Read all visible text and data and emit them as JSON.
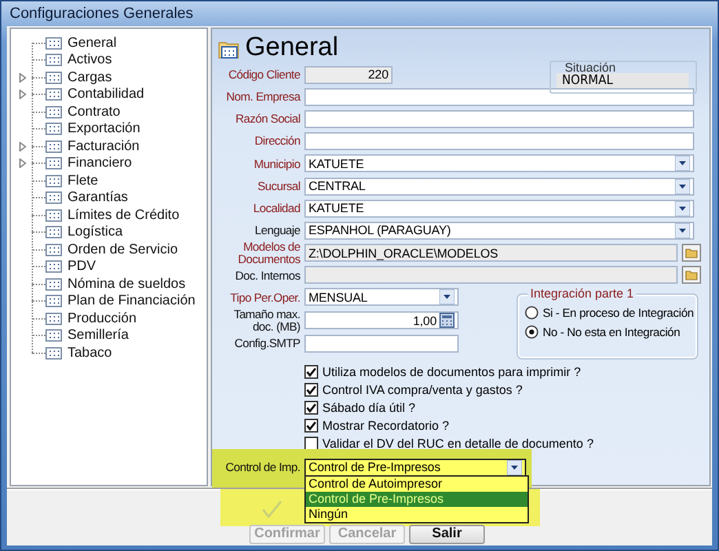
{
  "window": {
    "title": "Configuraciones Generales"
  },
  "tree": {
    "items": [
      {
        "label": "General",
        "expandable": false
      },
      {
        "label": "Activos",
        "expandable": false
      },
      {
        "label": "Cargas",
        "expandable": true
      },
      {
        "label": "Contabilidad",
        "expandable": true
      },
      {
        "label": "Contrato",
        "expandable": false
      },
      {
        "label": "Exportación",
        "expandable": false
      },
      {
        "label": "Facturación",
        "expandable": true
      },
      {
        "label": "Financiero",
        "expandable": true
      },
      {
        "label": "Flete",
        "expandable": false
      },
      {
        "label": "Garantías",
        "expandable": false
      },
      {
        "label": "Límites de Crédito",
        "expandable": false
      },
      {
        "label": "Logística",
        "expandable": false
      },
      {
        "label": "Orden de Servicio",
        "expandable": false
      },
      {
        "label": "PDV",
        "expandable": false
      },
      {
        "label": "Nómina de sueldos",
        "expandable": false
      },
      {
        "label": "Plan de Financiación",
        "expandable": false
      },
      {
        "label": "Producción",
        "expandable": false
      },
      {
        "label": "Semillería",
        "expandable": false
      },
      {
        "label": "Tabaco",
        "expandable": false
      }
    ]
  },
  "header": {
    "title": "General"
  },
  "codigo_cliente": {
    "label": "Código Cliente",
    "value": "220",
    "required": true,
    "disabled": true
  },
  "situacion": {
    "label": "Situación",
    "value": "NORMAL"
  },
  "fields": [
    {
      "kind": "text",
      "label": "Nom. Empresa",
      "required": true,
      "disabled": false
    },
    {
      "kind": "text",
      "label": "Razón Social",
      "required": true,
      "disabled": false
    },
    {
      "kind": "text",
      "label": "Dirección",
      "required": true,
      "disabled": false
    },
    {
      "kind": "combo",
      "label": "Municipio",
      "value": "KATUETE",
      "required": true,
      "disabled": false
    },
    {
      "kind": "combo",
      "label": "Sucursal",
      "value": "CENTRAL",
      "required": true,
      "disabled": false
    },
    {
      "kind": "combo",
      "label": "Localidad",
      "value": "KATUETE",
      "required": true,
      "disabled": false
    },
    {
      "kind": "combo",
      "label": "Lenguaje",
      "value": "ESPANHOL (PARAGUAY)",
      "required": false,
      "disabled": false
    },
    {
      "kind": "path",
      "label": "Modelos de Documentos",
      "value": "Z:\\DOLPHIN_ORACLE\\MODELOS",
      "required": true,
      "disabled": true
    },
    {
      "kind": "path",
      "label": "Doc. Internos",
      "required": false,
      "disabled": true
    }
  ],
  "small_fields": [
    {
      "kind": "combo",
      "label": "Tipo Per.Oper.",
      "value": "MENSUAL",
      "required": true
    },
    {
      "kind": "number",
      "label": "Tamaño max. doc. (MB)",
      "value": "1,00",
      "required": false
    },
    {
      "kind": "text",
      "label": "Config.SMTP",
      "required": false
    }
  ],
  "integracion": {
    "title": "Integración parte 1",
    "options": [
      {
        "label": "Si - En proceso de Integración",
        "selected": false
      },
      {
        "label": "No - No esta en Integración",
        "selected": true
      }
    ]
  },
  "checkboxes": [
    {
      "label": "Utiliza modelos de documentos para imprimir ?",
      "checked": true
    },
    {
      "label": "Control IVA compra/venta y gastos ?",
      "checked": true
    },
    {
      "label": "Sábado día útil ?",
      "checked": true
    },
    {
      "label": "Mostrar Recordatorio ?",
      "checked": true
    },
    {
      "label": "Validar el DV del RUC en detalle de documento ?",
      "checked": false
    }
  ],
  "control_imp": {
    "label": "Control de Imp.",
    "value": "Control de Pre-Impresos",
    "open": true,
    "highlighted": true,
    "options": [
      {
        "label": "Control de Autoimpresor",
        "selected": false
      },
      {
        "label": "Control de Pre-Impresos",
        "selected": true
      },
      {
        "label": "Ningún",
        "selected": false
      }
    ]
  },
  "buttons": [
    {
      "label": "Confirmar",
      "disabled": true
    },
    {
      "label": "Cancelar",
      "disabled": true
    },
    {
      "label": "Salir",
      "disabled": false
    }
  ]
}
